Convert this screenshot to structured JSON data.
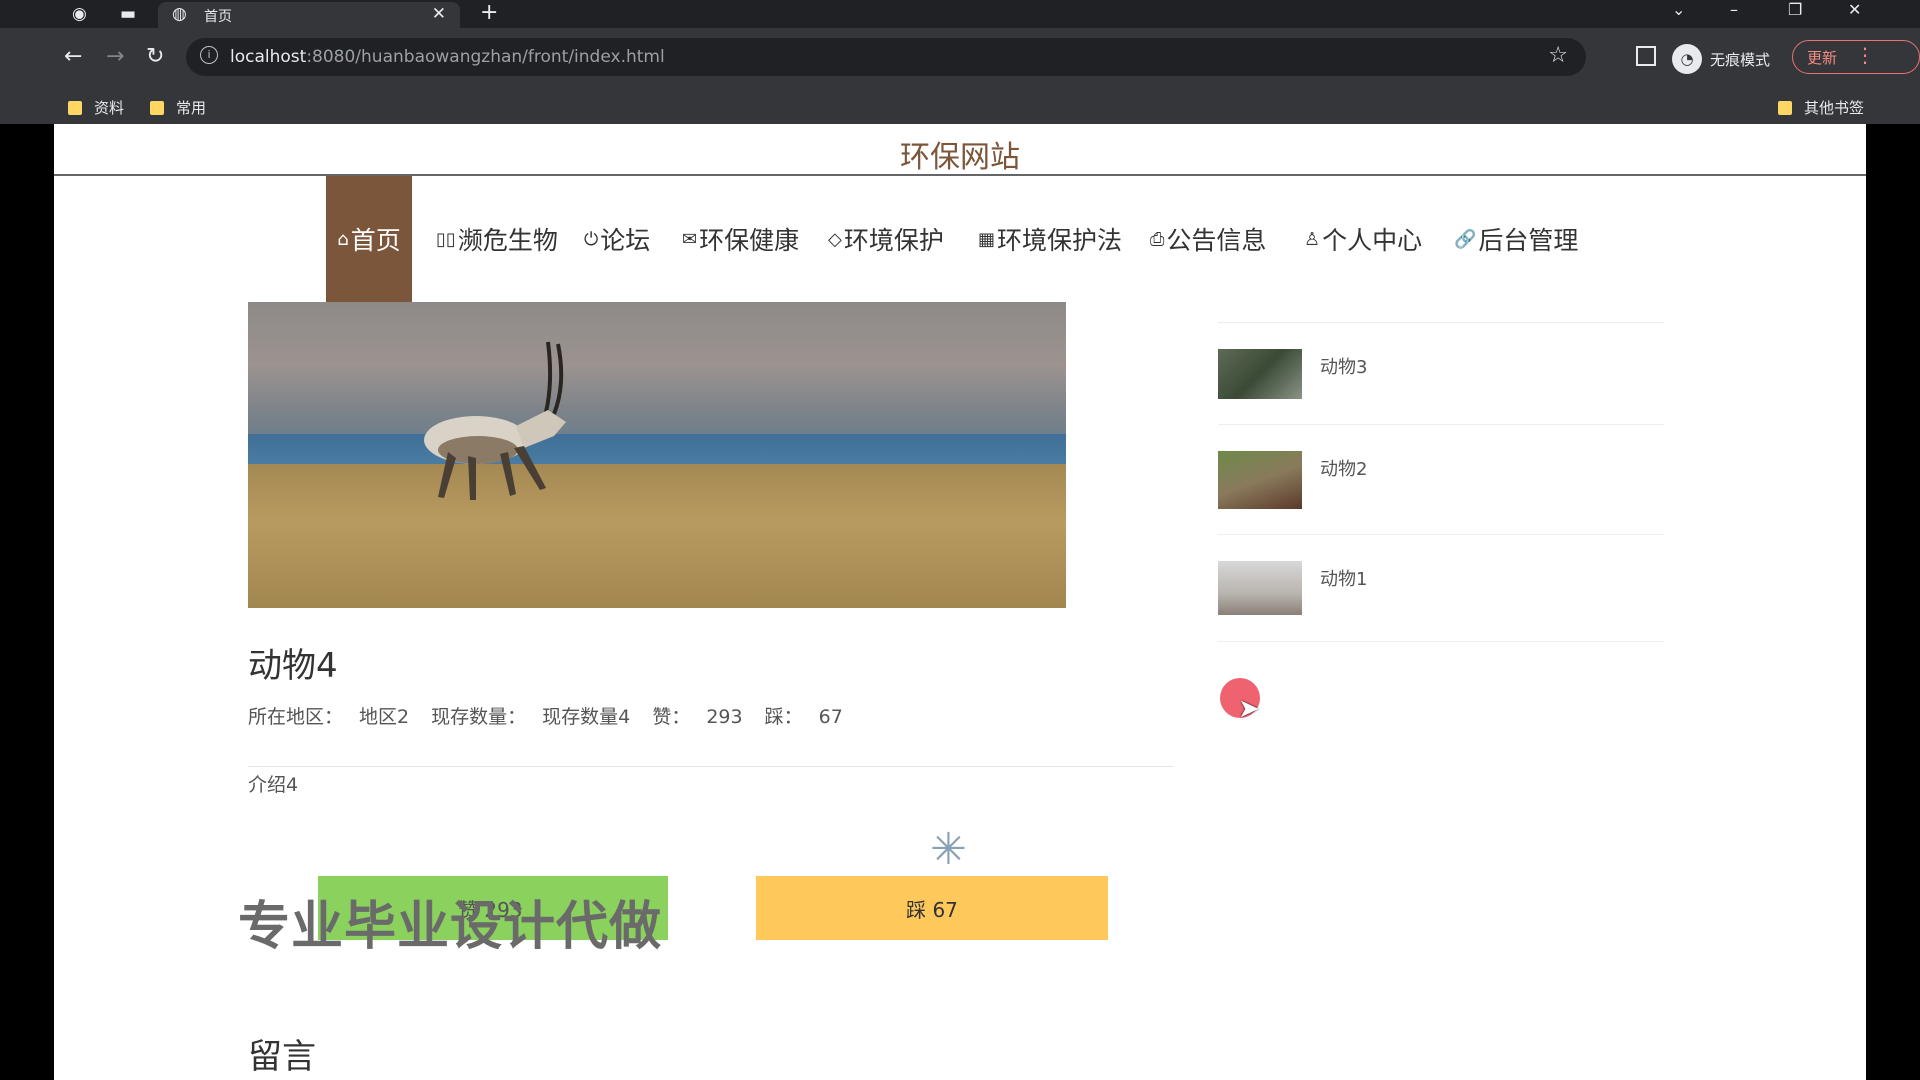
{
  "browser": {
    "tab_title": "首页",
    "url_host": "localhost",
    "url_rest": ":8080/huanbaowangzhan/front/index.html",
    "incognito_label": "无痕模式",
    "update_label": "更新",
    "bookmarks": [
      "资料",
      "常用"
    ],
    "other_bookmarks": "其他书签"
  },
  "site": {
    "title": "环保网站",
    "nav": [
      {
        "icon": "⌂",
        "label": "首页"
      },
      {
        "icon": "▯▯",
        "label": "濒危生物"
      },
      {
        "icon": "⏻",
        "label": "论坛"
      },
      {
        "icon": "✉",
        "label": "环保健康"
      },
      {
        "icon": "◇",
        "label": "环境保护"
      },
      {
        "icon": "▦",
        "label": "环境保护法"
      },
      {
        "icon": "⎙",
        "label": "公告信息"
      },
      {
        "icon": "♙",
        "label": "个人中心"
      },
      {
        "icon": "🔗",
        "label": "后台管理"
      }
    ]
  },
  "detail": {
    "title": "动物4",
    "region_label": "所在地区：",
    "region_value": "地区2",
    "count_label": "现存数量：",
    "count_value": "现存数量4",
    "likes_label": "赞：",
    "likes_value": "293",
    "dislikes_label": "踩：",
    "dislikes_value": "67",
    "intro": "介绍4",
    "like_button": "赞 293",
    "dislike_button": "踩  67",
    "watermark": "专业毕业设计代做",
    "comment_heading": "留言"
  },
  "sidebar": {
    "items": [
      {
        "name": "动物3"
      },
      {
        "name": "动物2"
      },
      {
        "name": "动物1"
      }
    ]
  }
}
